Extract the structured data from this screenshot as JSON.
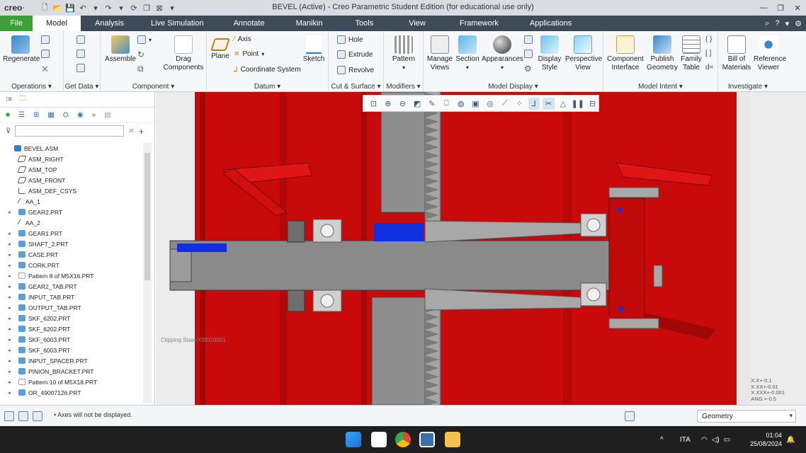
{
  "window": {
    "app_logo": "creo",
    "title": "BEVEL (Active) - Creo Parametric Student Edition (for educational use only)"
  },
  "tabs": [
    "File",
    "Model",
    "Analysis",
    "Live Simulation",
    "Annotate",
    "Manikin",
    "Tools",
    "View",
    "Framework",
    "Applications"
  ],
  "active_tab": "Model",
  "ribbon": {
    "operations": {
      "label": "Operations",
      "regenerate": "Regenerate"
    },
    "get_data": {
      "label": "Get Data"
    },
    "component": {
      "label": "Component",
      "assemble": "Assemble",
      "drag": "Drag Components"
    },
    "datum": {
      "label": "Datum",
      "plane": "Plane",
      "axis": "Axis",
      "point": "Point",
      "coord": "Coordinate System",
      "sketch": "Sketch"
    },
    "cut_surface": {
      "label": "Cut & Surface",
      "hole": "Hole",
      "extrude": "Extrude",
      "revolve": "Revolve"
    },
    "modifiers": {
      "label": "Modifiers",
      "pattern": "Pattern"
    },
    "model_display": {
      "label": "Model Display",
      "manage_views": "Manage Views",
      "section": "Section",
      "appearances": "Appearances",
      "display_style": "Display Style",
      "perspective_view": "Perspective View"
    },
    "model_intent": {
      "label": "Model Intent",
      "component_interface": "Component Interface",
      "publish_geometry": "Publish Geometry",
      "family_table": "Family Table"
    },
    "investigate": {
      "label": "Investigate",
      "bill_of_materials": "Bill of Materials",
      "reference_viewer": "Reference Viewer"
    }
  },
  "model_tree": [
    {
      "name": "BEVEL.ASM",
      "type": "asm",
      "expand": ""
    },
    {
      "name": "ASM_RIGHT",
      "type": "plane",
      "expand": ""
    },
    {
      "name": "ASM_TOP",
      "type": "plane",
      "expand": ""
    },
    {
      "name": "ASM_FRONT",
      "type": "plane",
      "expand": ""
    },
    {
      "name": "ASM_DEF_CSYS",
      "type": "csys",
      "expand": ""
    },
    {
      "name": "AA_1",
      "type": "axis",
      "expand": ""
    },
    {
      "name": "GEAR2.PRT",
      "type": "part",
      "expand": "▸"
    },
    {
      "name": "AA_2",
      "type": "axis",
      "expand": ""
    },
    {
      "name": "GEAR1.PRT",
      "type": "part",
      "expand": "▸"
    },
    {
      "name": "SHAFT_2.PRT",
      "type": "part",
      "expand": "▸"
    },
    {
      "name": "CASE.PRT",
      "type": "part",
      "expand": "▸"
    },
    {
      "name": "CORK.PRT",
      "type": "part",
      "expand": "▸"
    },
    {
      "name": "Pattern 8 of M5X16.PRT",
      "type": "pattern",
      "expand": "▸"
    },
    {
      "name": "GEAR2_TAB.PRT",
      "type": "part",
      "expand": "▸"
    },
    {
      "name": "INPUT_TAB.PRT",
      "type": "part",
      "expand": "▸"
    },
    {
      "name": "OUTPUT_TAB.PRT",
      "type": "part",
      "expand": "▸"
    },
    {
      "name": "SKF_6202.PRT",
      "type": "part",
      "expand": "▸"
    },
    {
      "name": "SKF_6202.PRT",
      "type": "part",
      "expand": "▸"
    },
    {
      "name": "SKF_6003.PRT",
      "type": "part",
      "expand": "▸"
    },
    {
      "name": "SKF_6003.PRT",
      "type": "part",
      "expand": "▸"
    },
    {
      "name": "INPUT_SPACER.PRT",
      "type": "part",
      "expand": "▸"
    },
    {
      "name": "PINION_BRACKET.PRT",
      "type": "part",
      "expand": "▸"
    },
    {
      "name": "Pattern 10 of M5X18.PRT",
      "type": "pattern",
      "expand": "▸"
    },
    {
      "name": "OR_49007126.PRT",
      "type": "part",
      "expand": "▸"
    }
  ],
  "viewport": {
    "clipping_state": "Clipping State:XSEC0001",
    "tolerances": [
      "X.X+-0.1",
      "X.XX+-0.01",
      "X.XXX+-0.001",
      "ANG.+-0.5"
    ]
  },
  "status": {
    "message": "Axes will not be displayed.",
    "filter": "Geometry"
  },
  "taskbar": {
    "lang": "ITA",
    "time": "01:04",
    "date": "25/08/2024"
  },
  "colors": {
    "case_red": "#c80a0a",
    "steel_gray": "#8a8a8a",
    "tab_bar": "#3d4a57",
    "file_green": "#3ca038",
    "highlight_blue": "#1030e0"
  }
}
